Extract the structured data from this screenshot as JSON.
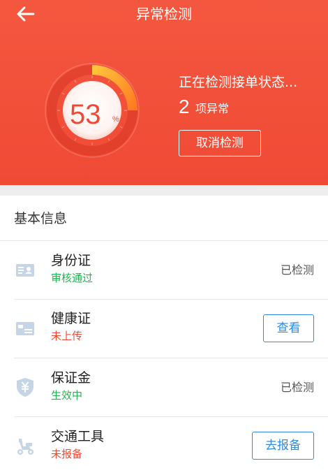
{
  "header": {
    "title": "异常检测",
    "back_icon": "arrow-left-icon",
    "bg_color": "#f2503a"
  },
  "progress": {
    "value": "53",
    "unit": "%",
    "fraction": 0.53
  },
  "detection": {
    "status_text": "正在检测接单状态...",
    "anomaly_count": "2",
    "anomaly_label": "项异常",
    "cancel_label": "取消检测"
  },
  "basic_info": {
    "title": "基本信息",
    "items": [
      {
        "name": "身份证",
        "status": "审核通过",
        "status_color": "green",
        "icon": "id-card-icon",
        "state": "已检测"
      },
      {
        "name": "健康证",
        "status": "未上传",
        "status_color": "red",
        "icon": "health-card-icon",
        "action": "查看"
      },
      {
        "name": "保证金",
        "status": "生效中",
        "status_color": "green",
        "icon": "deposit-shield-icon",
        "state": "已检测"
      },
      {
        "name": "交通工具",
        "status": "未报备",
        "status_color": "red",
        "icon": "scooter-icon",
        "action": "去报备"
      }
    ]
  },
  "colors": {
    "accent": "#f04a35",
    "success": "#1fb64f",
    "link": "#2d8ce0"
  }
}
